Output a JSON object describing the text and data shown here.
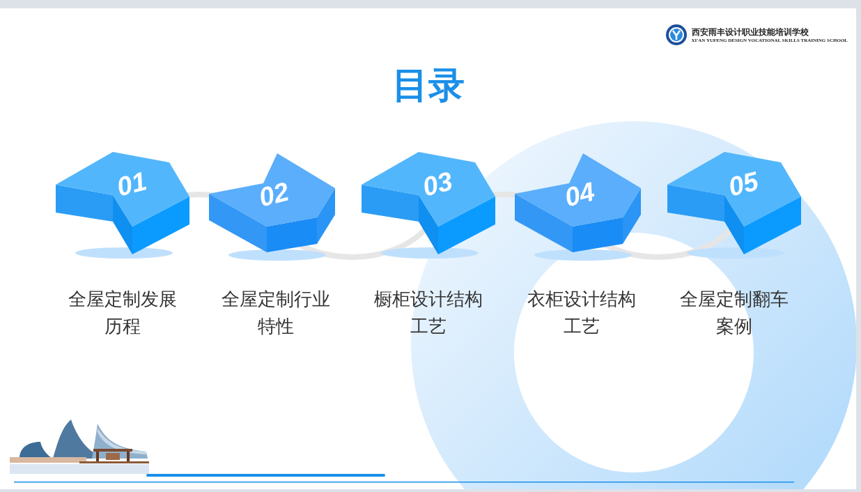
{
  "logo": {
    "name": "西安雨丰设计职业技能培训学校",
    "subtitle": "XI'AN YUFENG DESIGN VOCATIONAL SKILLS TRAINING SCHOOL"
  },
  "title": "目录",
  "items": [
    {
      "number": "01",
      "kind": "up",
      "label_lines": [
        "全屋定制发展",
        "历程"
      ]
    },
    {
      "number": "02",
      "kind": "down",
      "label_lines": [
        "全屋定制行业",
        "特性"
      ]
    },
    {
      "number": "03",
      "kind": "up",
      "label_lines": [
        "橱柜设计结构",
        "工艺"
      ]
    },
    {
      "number": "04",
      "kind": "down",
      "label_lines": [
        "衣柜设计结构",
        "工艺"
      ]
    },
    {
      "number": "05",
      "kind": "up",
      "label_lines": [
        "全屋定制翻车",
        "案例"
      ]
    }
  ]
}
